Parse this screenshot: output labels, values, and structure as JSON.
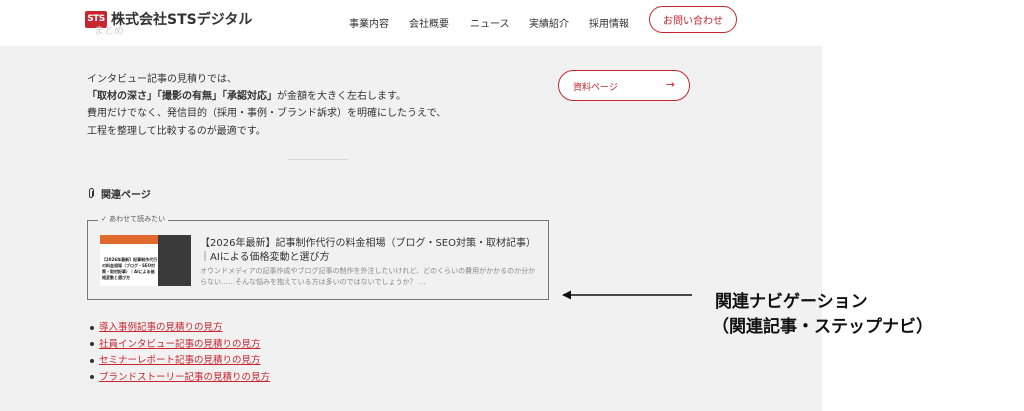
{
  "header": {
    "logo_mark": "STS",
    "logo_text": "株式会社STSデジタル",
    "nav": [
      "事業内容",
      "会社概要",
      "ニュース",
      "実績紹介",
      "採用情報"
    ],
    "contact_label": "お問い合わせ"
  },
  "ghost_heading": "まとめ",
  "summary": {
    "line1": "インタビュー記事の見積りでは、",
    "line2_bold1": "「取材の深さ」",
    "line2_bold2": "「撮影の有無」",
    "line2_bold3": "「承認対応」",
    "line2_rest": "が金額を大きく左右します。",
    "line3": "費用だけでなく、発信目的（採用・事例・ブランド訴求）を明確にしたうえで、",
    "line4": "工程を整理して比較するのが最適です。"
  },
  "doc_button": {
    "label": "資料ページ",
    "arrow": "→"
  },
  "related": {
    "heading": "関連ページ",
    "icon": "paperclip-icon",
    "card": {
      "tag": "あわせて読みたい",
      "thumb_text": "【2026年最新】記事制作代行の料金相場（ブログ・SEO対策・取材記事）｜AIによる価格変動と選び方",
      "title": "【2026年最新】記事制作代行の料金相場（ブログ・SEO対策・取材記事）｜AIによる価格変動と選び方",
      "description": "オウンドメディアの記事作成やブログ記事の制作を外注したいけれど、どのくらいの費用がかかるのか分からない……そんな悩みを抱えている方は多いのではないでしょうか？ …"
    },
    "links": [
      "導入事例記事の見積りの見方",
      "社員インタビュー記事の見積りの見方",
      "セミナーレポート記事の見積りの見方",
      "ブランドストーリー記事の見積りの見方"
    ]
  },
  "annotation": {
    "line1": "関連ナビゲーション",
    "line2": "（関連記事・ステップナビ）"
  },
  "colors": {
    "accent": "#c8262f",
    "page_bg": "#f1f1f1"
  }
}
